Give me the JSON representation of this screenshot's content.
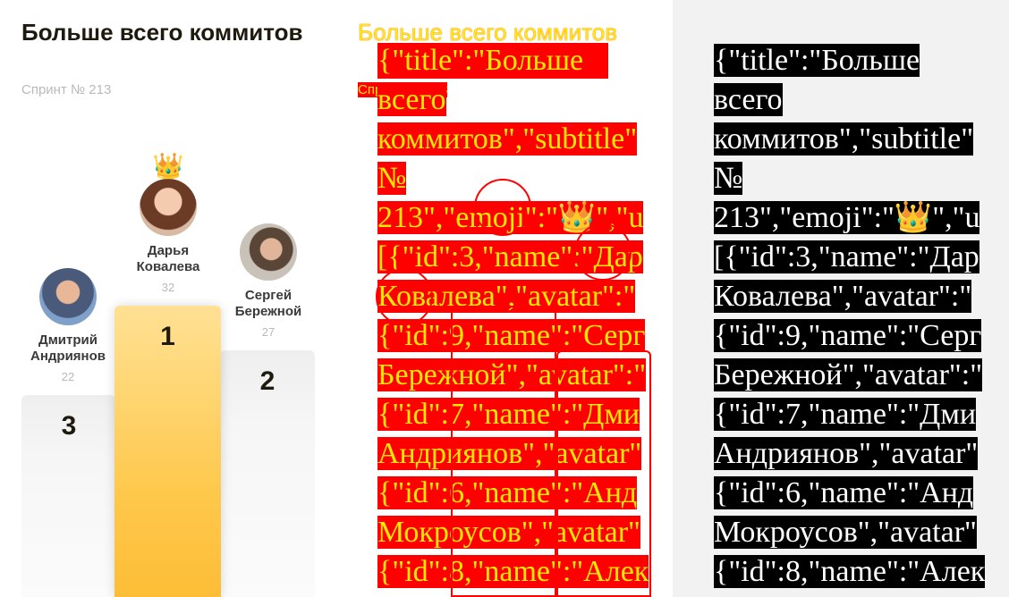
{
  "title": "Больше всего коммитов",
  "subtitle": "Спринт № 213",
  "emoji": "👑",
  "leaders": [
    {
      "place": "1",
      "name_line1": "Дарья",
      "name_line2": "Ковалева",
      "value": "32"
    },
    {
      "place": "2",
      "name_line1": "Сергей",
      "name_line2": "Бережной",
      "value": "27"
    },
    {
      "place": "3",
      "name_line1": "Дмитрий",
      "name_line2": "Андриянов",
      "value": "22"
    }
  ],
  "raw_json_lines": [
    "{\"title\":\"Больше",
    "всего",
    "коммитов\",\"subtitle\"",
    "№",
    "213\",\"emoji\":\"👑\",\"u",
    "[{\"id\":3,\"name\":\"Дар",
    "Ковалева\",\"avatar\":\"",
    "{\"id\":9,\"name\":\"Серг",
    "Бережной\",\"avatar\":\"",
    "{\"id\":7,\"name\":\"Дми",
    "Андриянов\",\"avatar\"",
    "{\"id\":6,\"name\":\"Анд",
    "Мокроусов\",\"avatar\"",
    "{\"id\":8,\"name\":\"Алек"
  ],
  "colors": {
    "title": "#1f1a0e",
    "muted": "#b9b9b9",
    "gold": "#fec84b",
    "silver": "#f4f4f4",
    "overlay_red": "#ff0000",
    "overlay_yellow": "#ffea00"
  }
}
